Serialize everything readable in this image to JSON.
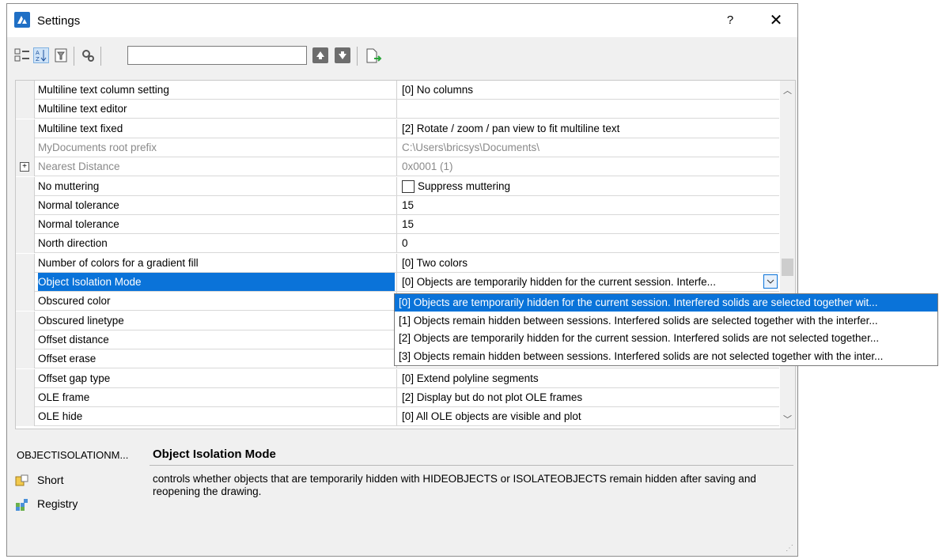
{
  "window": {
    "title": "Settings",
    "help_label": "?",
    "close_label": "✕"
  },
  "toolbar": {
    "search_value": "",
    "icons": [
      "categorized-view-icon",
      "alphabetic-view-icon",
      "filter-icon",
      "settings-icon",
      "move-up-icon",
      "move-down-icon",
      "export-icon"
    ]
  },
  "grid": {
    "rows": [
      {
        "name": "Multiline text column setting",
        "value": "[0] No columns"
      },
      {
        "name": "Multiline text editor",
        "value": ""
      },
      {
        "name": "Multiline text fixed",
        "value": "[2] Rotate / zoom / pan view to fit multiline text"
      },
      {
        "name": "MyDocuments root prefix",
        "value": "C:\\Users\\bricsys\\Documents\\",
        "state": "dim"
      },
      {
        "name": "Nearest Distance",
        "value": "0x0001 (1)",
        "state": "dim",
        "expander": "+"
      },
      {
        "name": "No muttering",
        "value": "Suppress muttering",
        "checkbox": true
      },
      {
        "name": "Normal tolerance",
        "value": "15"
      },
      {
        "name": "Normal tolerance",
        "value": "15"
      },
      {
        "name": "North direction",
        "value": "0"
      },
      {
        "name": "Number of colors for a gradient fill",
        "value": "[0] Two colors"
      },
      {
        "name": "Object Isolation Mode",
        "value": "[0] Objects are temporarily hidden for the current session. Interfe...",
        "state": "selected"
      },
      {
        "name": "Obscured color",
        "value": ""
      },
      {
        "name": "Obscured linetype",
        "value": ""
      },
      {
        "name": "Offset distance",
        "value": ""
      },
      {
        "name": "Offset erase",
        "value": ""
      },
      {
        "name": "Offset gap type",
        "value": "[0] Extend polyline segments"
      },
      {
        "name": "OLE frame",
        "value": "[2] Display but do not plot OLE frames"
      },
      {
        "name": "OLE hide",
        "value": "[0] All OLE objects are visible and plot"
      }
    ],
    "dropdown_options": [
      "[0] Objects are temporarily hidden for the current session. Interfered solids are selected together wit...",
      "[1] Objects remain hidden between sessions. Interfered solids are selected together with the interfer...",
      "[2] Objects are temporarily hidden for the current session. Interfered solids are not selected together...",
      "[3] Objects remain hidden between sessions. Interfered solids are not selected together with the inter..."
    ],
    "selected_option_index": 0
  },
  "description": {
    "variable": "OBJECTISOLATIONM...",
    "title": "Object Isolation Mode",
    "text": "controls whether objects that are temporarily hidden with HIDEOBJECTS or ISOLATEOBJECTS remain hidden after saving and reopening the drawing.",
    "items": [
      {
        "label": "Short",
        "icon": "short-name-icon"
      },
      {
        "label": "Registry",
        "icon": "registry-icon"
      }
    ]
  },
  "colors": {
    "selection": "#0a73d9",
    "window_bg": "#f0f0f0",
    "app_icon": "#1f6fc5"
  }
}
